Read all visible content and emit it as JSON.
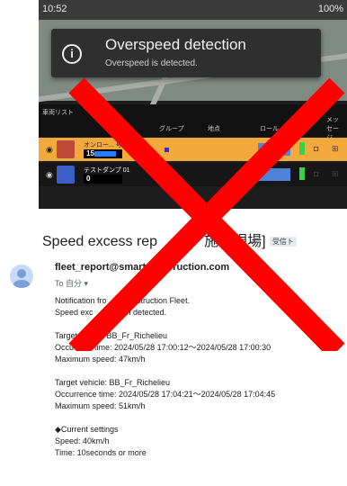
{
  "status_bar": {
    "time": "10:52",
    "battery": "100%"
  },
  "toast": {
    "title": "Overspeed detection",
    "message": "Overspeed is detected."
  },
  "vehicle_list": {
    "header_title": "車両リスト",
    "col_name": "名",
    "col_group": "グループ",
    "col_point": "地点",
    "col_role": "ロール",
    "col_msg": "メッセージ",
    "rows": [
      {
        "name": "オンロー... 号機",
        "speed": "15"
      },
      {
        "name": "テストダンプ 01",
        "speed": "0"
      }
    ]
  },
  "email": {
    "subject": "Speed excess rep",
    "subject_tail": "施工現場]",
    "badge": "受信ト",
    "sender": "fleet_report@smart",
    "sender_tail": "ruction.com",
    "to": "To 自分 ▾",
    "lines": [
      "Notification fro",
      "Speed exc",
      "",
      "Target",
      "Occu",
      "Maximum speed: 47km/h",
      "",
      "Target vehicle: BB_Fr_Richelieu",
      "Occurrence time: 2024/05/28 17:04:21～2024/05/28 17:04:45",
      "Maximum speed: 51km/h",
      "",
      "◆Current settings",
      " Speed: 40km/h",
      " Time: 10seconds or more"
    ],
    "line1_tail": "t Construction Fleet.",
    "line2_tail": "been detected.",
    "line4_tail": "icle: BB_Fr_Richelieu",
    "line5_tail": "nce time: 2024/05/28 17:00:12～2024/05/28 17:00:30"
  },
  "colors": {
    "accent_orange": "#f3a93b",
    "cross_red": "#ff0000"
  }
}
